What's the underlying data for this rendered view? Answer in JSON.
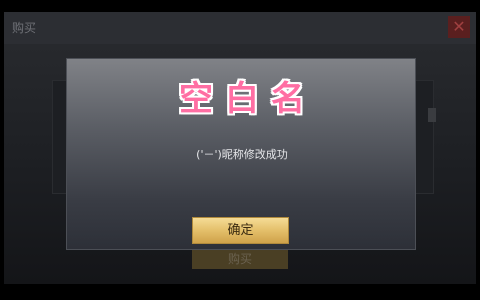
{
  "background": {
    "title": "购买",
    "buy_button_label": "购买",
    "close_icon": "close-icon"
  },
  "dialog": {
    "title": "空白名",
    "message": "('－')昵称修改成功",
    "confirm_label": "确定"
  },
  "colors": {
    "title_pink": "#ff6ea3",
    "button_gold": "#e4bf6a"
  }
}
